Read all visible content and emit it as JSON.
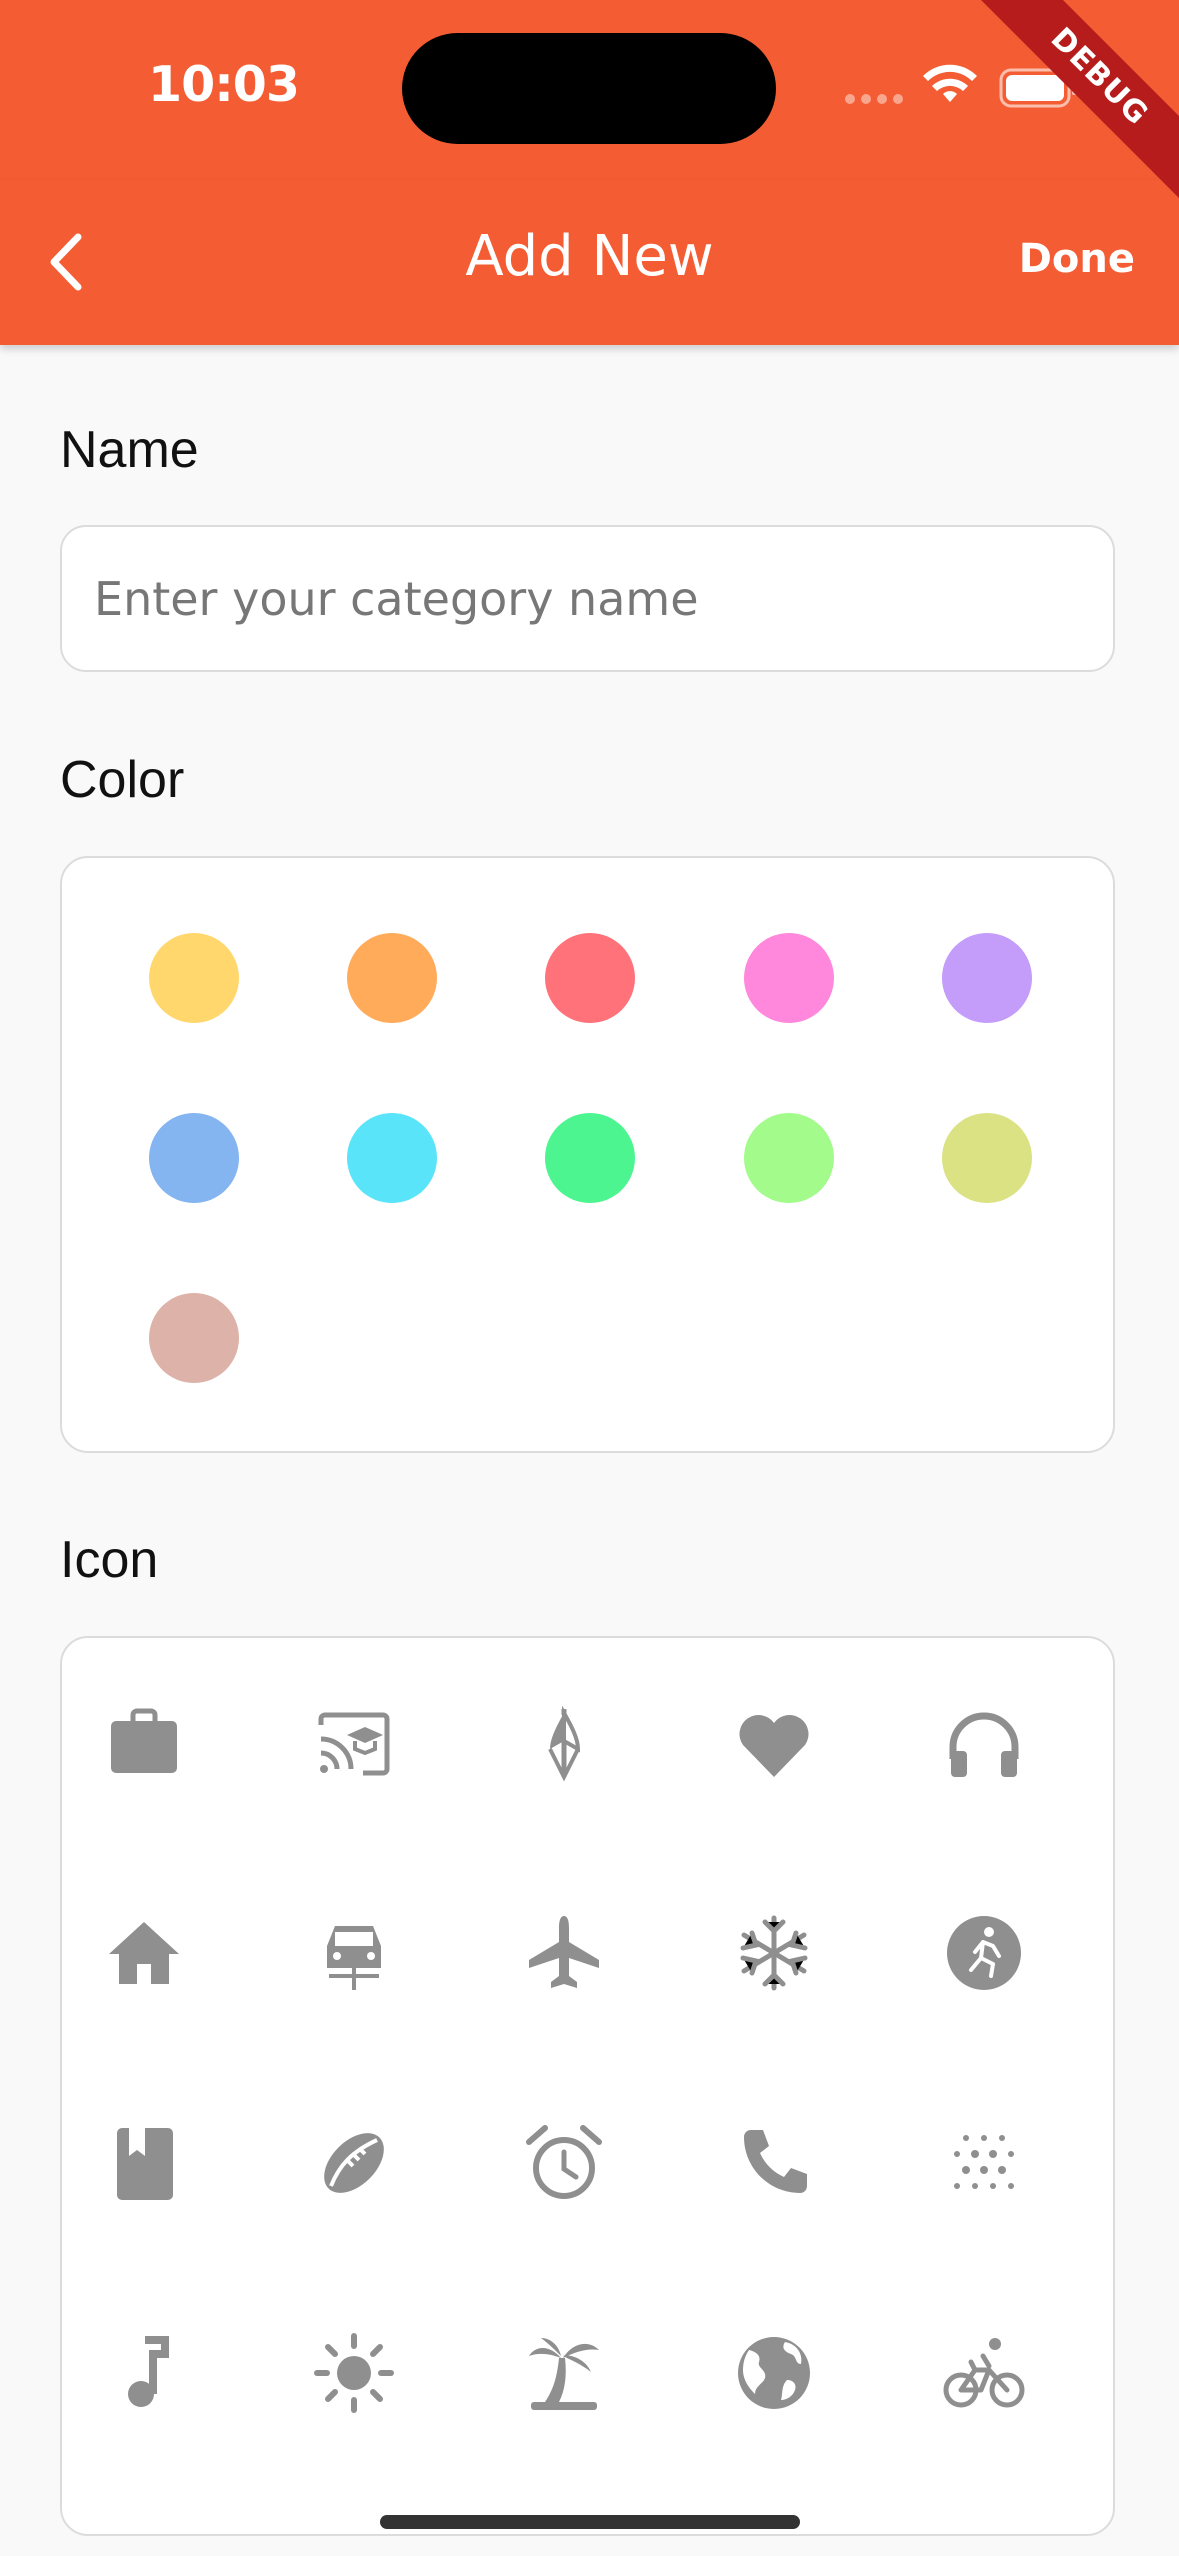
{
  "status_bar": {
    "time": "10:03"
  },
  "debug_banner": "DEBUG",
  "app_bar": {
    "title": "Add New",
    "done_label": "Done",
    "back_icon": "chevron-left-icon"
  },
  "name_section": {
    "label": "Name",
    "placeholder": "Enter your category name",
    "value": ""
  },
  "color_section": {
    "label": "Color",
    "colors": [
      "#ffd76c",
      "#ffab5a",
      "#ff7279",
      "#ff88dd",
      "#c49cf9",
      "#84b5f0",
      "#5ae4fa",
      "#4cf58f",
      "#a2fb8b",
      "#dbe284",
      "#ddb2a8"
    ]
  },
  "icon_section": {
    "label": "Icon",
    "icon_color": "#8f8f8f",
    "icons": [
      "briefcase-icon",
      "cast-for-education-icon",
      "umbrella-icon",
      "heart-icon",
      "headphones-icon",
      "home-icon",
      "car-icon",
      "airplane-icon",
      "snowflake-icon",
      "running-icon",
      "book-icon",
      "rugby-ball-icon",
      "alarm-icon",
      "phone-icon",
      "dots-grid-icon",
      "music-note-icon",
      "sun-icon",
      "palm-tree-icon",
      "globe-icon",
      "bicycle-icon"
    ]
  }
}
